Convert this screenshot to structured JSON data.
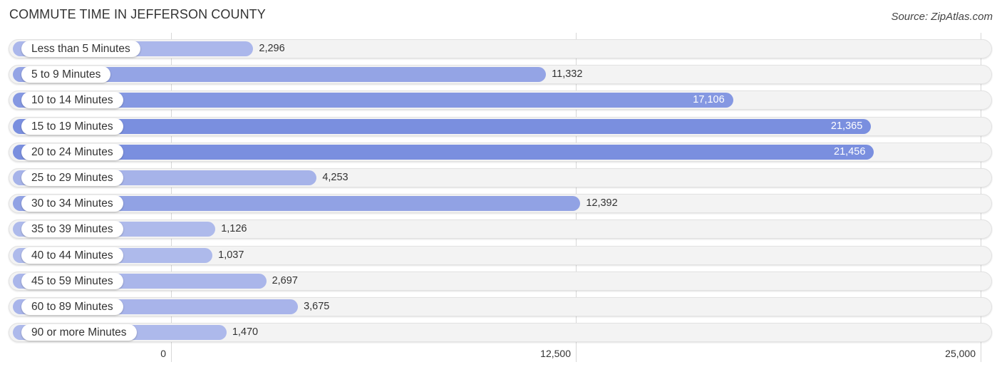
{
  "header": {
    "title": "COMMUTE TIME IN JEFFERSON COUNTY",
    "source": "Source: ZipAtlas.com"
  },
  "colors": {
    "bar_dark": "#7a8fdf",
    "bar_light": "#b1bcec",
    "track": "#f3f3f3"
  },
  "chart_data": {
    "type": "bar",
    "orientation": "horizontal",
    "title": "COMMUTE TIME IN JEFFERSON COUNTY",
    "xlabel": "",
    "ylabel": "",
    "xlim": [
      0,
      25000
    ],
    "grid": true,
    "categories": [
      "Less than 5 Minutes",
      "5 to 9 Minutes",
      "10 to 14 Minutes",
      "15 to 19 Minutes",
      "20 to 24 Minutes",
      "25 to 29 Minutes",
      "30 to 34 Minutes",
      "35 to 39 Minutes",
      "40 to 44 Minutes",
      "45 to 59 Minutes",
      "60 to 89 Minutes",
      "90 or more Minutes"
    ],
    "values": [
      2296,
      11332,
      17106,
      21365,
      21456,
      4253,
      12392,
      1126,
      1037,
      2697,
      3675,
      1470
    ],
    "value_labels": [
      "2,296",
      "11,332",
      "17,106",
      "21,365",
      "21,456",
      "4,253",
      "12,392",
      "1,126",
      "1,037",
      "2,697",
      "3,675",
      "1,470"
    ],
    "ticks": [
      {
        "value": 0,
        "label": "0"
      },
      {
        "value": 12500,
        "label": "12,500"
      },
      {
        "value": 25000,
        "label": "25,000"
      }
    ]
  }
}
